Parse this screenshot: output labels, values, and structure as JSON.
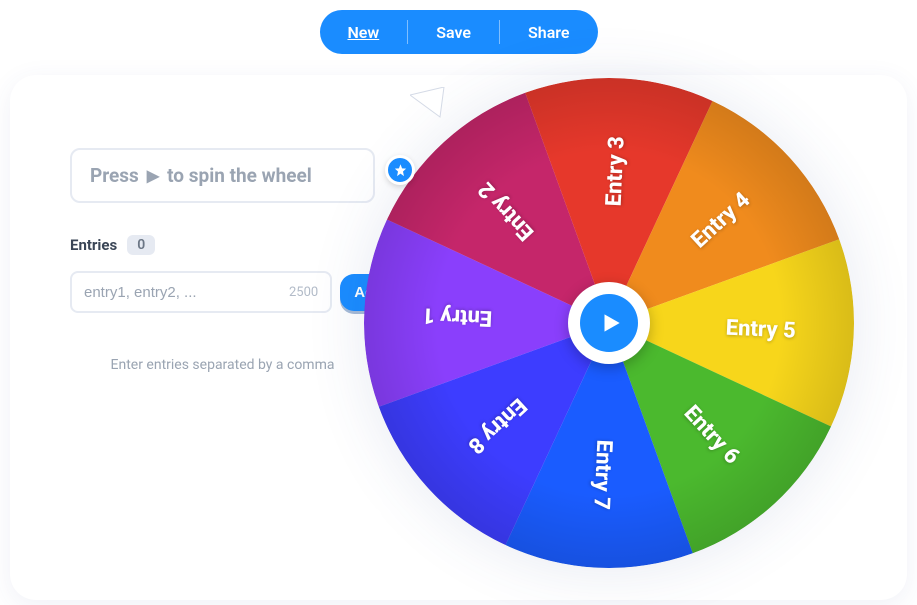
{
  "toolbar": {
    "new_label": "New",
    "save_label": "Save",
    "share_label": "Share"
  },
  "hint": {
    "prefix": "Press",
    "suffix": "to spin the wheel"
  },
  "entries": {
    "header_label": "Entries",
    "count": "0",
    "placeholder": "entry1, entry2, ...",
    "limit": "2500",
    "add_label": "Add",
    "helper": "Enter entries separated by a comma"
  },
  "wheel": {
    "segments": [
      {
        "label": "Entry 1",
        "color": "#8a3ffc"
      },
      {
        "label": "Entry 2",
        "color": "#c5266a"
      },
      {
        "label": "Entry 3",
        "color": "#e6382b"
      },
      {
        "label": "Entry 4",
        "color": "#f08b1d"
      },
      {
        "label": "Entry 5",
        "color": "#f7d61b"
      },
      {
        "label": "Entry 6",
        "color": "#4bb92e"
      },
      {
        "label": "Entry 7",
        "color": "#1a5cff"
      },
      {
        "label": "Entry 8",
        "color": "#3d3dff"
      }
    ]
  }
}
